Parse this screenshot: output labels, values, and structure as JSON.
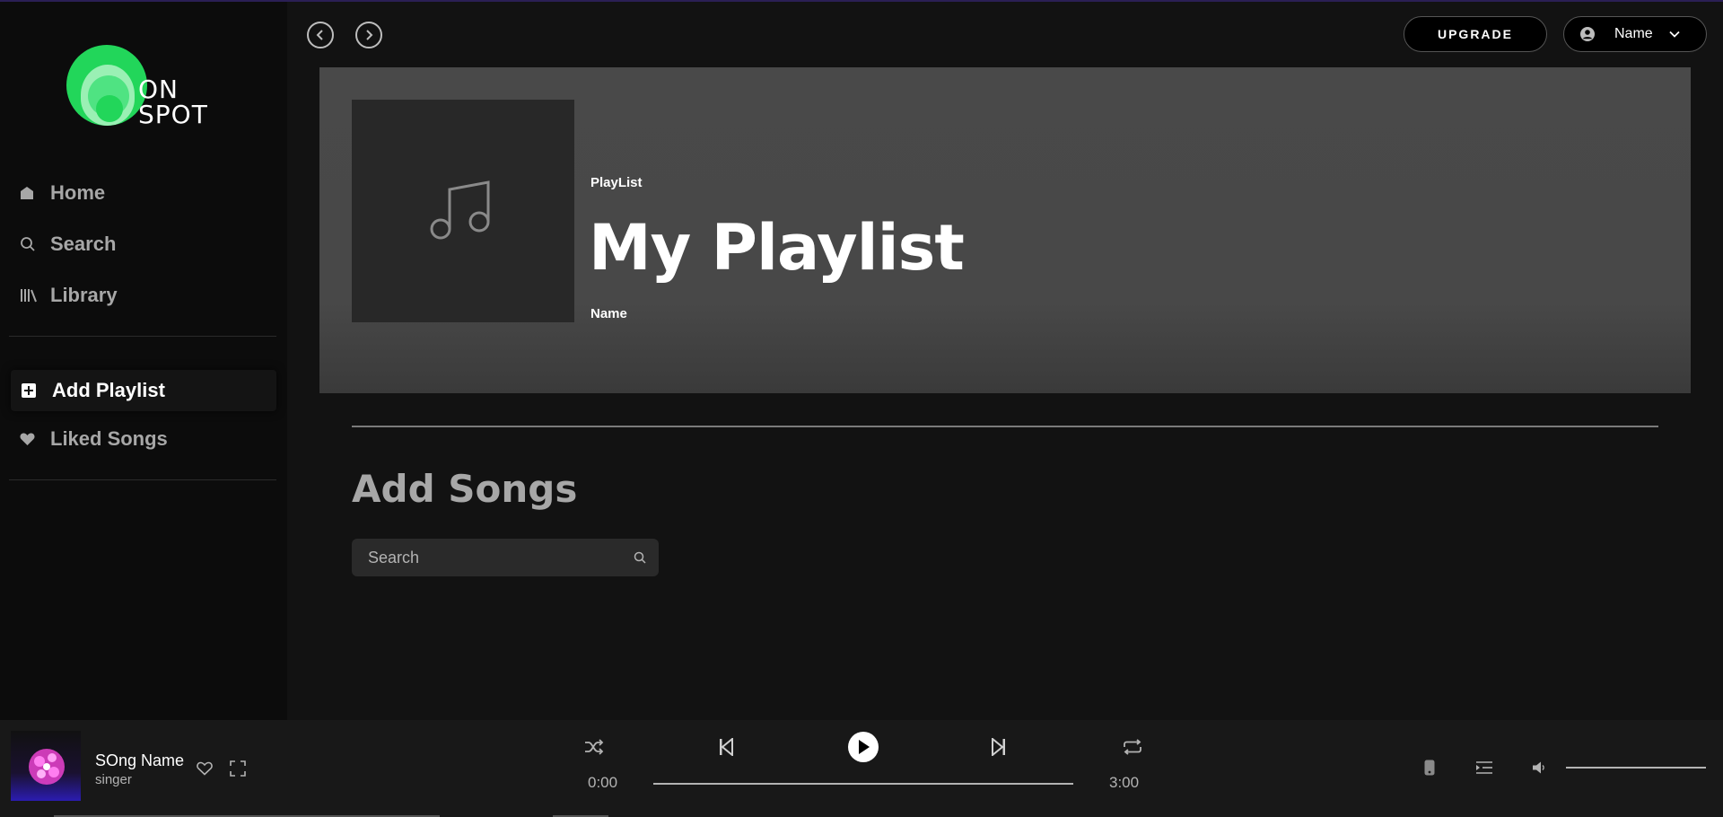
{
  "app": {
    "logo_line1": "ON",
    "logo_line2": "SPOT",
    "accent_color": "#22d65a"
  },
  "sidebar": {
    "items": [
      {
        "label": "Home",
        "icon": "home-icon"
      },
      {
        "label": "Search",
        "icon": "search-icon"
      },
      {
        "label": "Library",
        "icon": "library-icon"
      },
      {
        "label": "Add Playlist",
        "icon": "plus-square-icon",
        "active": true
      },
      {
        "label": "Liked Songs",
        "icon": "heart-icon"
      }
    ]
  },
  "header": {
    "upgrade_label": "UPGRADE",
    "user_name": "Name"
  },
  "playlist": {
    "kind": "PlayList",
    "title": "My Playlist",
    "owner": "Name",
    "cover_icon": "music-note-icon"
  },
  "add_songs": {
    "heading": "Add Songs",
    "search_placeholder": "Search"
  },
  "player": {
    "song_name": "SOng Name",
    "singer": "singer",
    "current_time": "0:00",
    "total_time": "3:00",
    "progress": 0,
    "volume": 1
  }
}
